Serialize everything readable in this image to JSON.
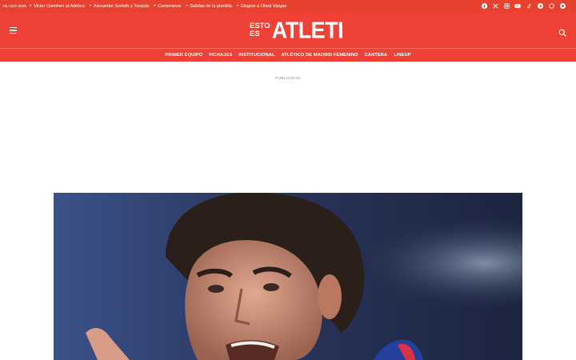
{
  "topbar": {
    "date": "05 AGO 2025",
    "trending": [
      "Victor Osimhen al Atlético",
      "Alexander Sorloth y Turquía",
      "Canteranos",
      "Salidas de la plantilla",
      "Elogios a Obed Vargas"
    ],
    "social_icons": [
      "facebook-icon",
      "x-icon",
      "instagram-icon",
      "youtube-icon",
      "tiktok-icon",
      "telegram-icon",
      "whatsapp-icon",
      "rss-icon",
      "user-icon"
    ]
  },
  "header": {
    "logo_small_1": "ESTO",
    "logo_small_2": "ES",
    "logo_big": "ATLETI"
  },
  "nav": {
    "items": [
      "PRIMER EQUIPO",
      "FICHAJES",
      "INSTITUCIONAL",
      "ATLÉTICO DE MADRID FEMENINO",
      "CANTERA",
      "LINEUP"
    ]
  },
  "ad": {
    "label": "PUBLICIDAD"
  },
  "colors": {
    "brand": "#ef4136",
    "topbar": "#e8412f"
  }
}
